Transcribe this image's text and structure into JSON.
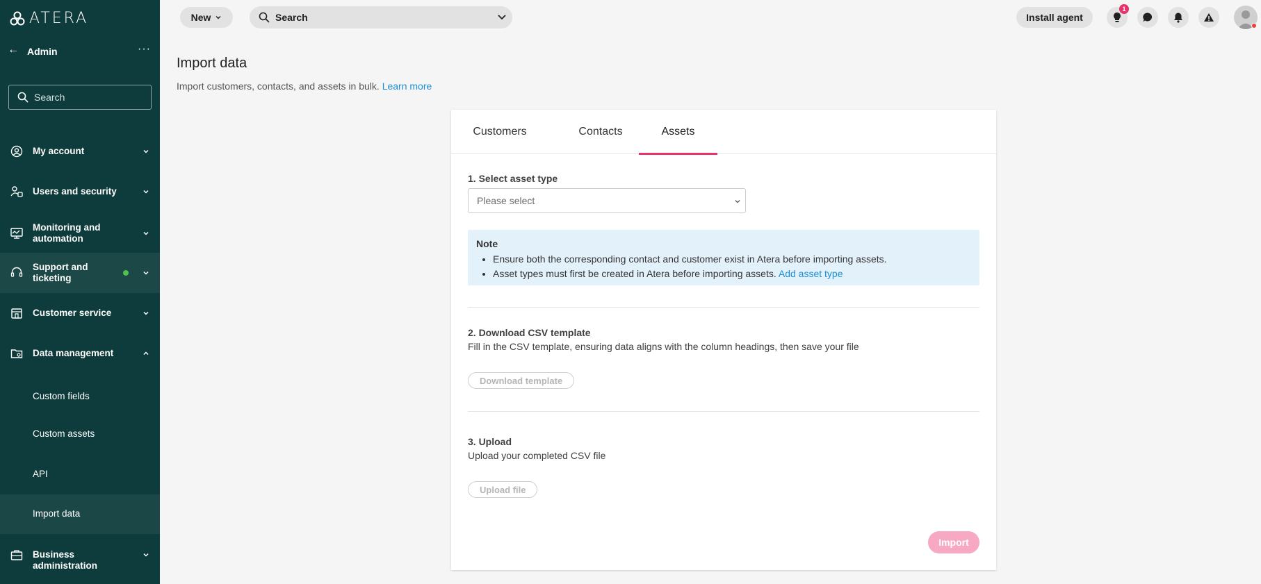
{
  "brand": {
    "logo_text": "ATERA"
  },
  "sidebar": {
    "back_label": "Admin",
    "search_placeholder": "Search",
    "items": [
      {
        "label": "My account",
        "icon": "user-circle-icon"
      },
      {
        "label": "Users and security",
        "icon": "users-lock-icon"
      },
      {
        "label": "Monitoring and automation",
        "icon": "monitor-icon"
      },
      {
        "label": "Support and ticketing",
        "icon": "headset-icon"
      },
      {
        "label": "Customer service",
        "icon": "storefront-icon"
      },
      {
        "label": "Data management",
        "icon": "folder-gear-icon"
      },
      {
        "label": "Business administration",
        "icon": "briefcase-icon"
      }
    ],
    "sub_items": [
      {
        "label": "Custom fields"
      },
      {
        "label": "Custom assets"
      },
      {
        "label": "API"
      },
      {
        "label": "Import data"
      }
    ]
  },
  "topbar": {
    "new_label": "New",
    "search_label": "Search",
    "install_label": "Install agent",
    "notification_count": "1"
  },
  "page": {
    "title": "Import data",
    "subtitle": "Import customers, contacts, and assets in bulk.",
    "learn_more": "Learn more"
  },
  "tabs": [
    "Customers",
    "Contacts",
    "Assets"
  ],
  "step1": {
    "title": "1. Select asset type",
    "placeholder": "Please select"
  },
  "note": {
    "title": "Note",
    "line1": "Ensure both the corresponding contact and customer exist in Atera before importing assets.",
    "line2": "Asset types must first be created in Atera before importing assets.",
    "link": "Add asset type"
  },
  "step2": {
    "title": "2. Download CSV template",
    "desc": "Fill in the CSV template, ensuring data aligns with the column headings, then save your file",
    "button": "Download template"
  },
  "step3": {
    "title": "3. Upload",
    "desc": "Upload your completed CSV file",
    "button": "Upload file"
  },
  "import_label": "Import",
  "colors": {
    "sidebar_bg": "#0e3b3b",
    "accent": "#e8336a",
    "link": "#1a8fd1",
    "note_bg": "#e3f1fb"
  }
}
